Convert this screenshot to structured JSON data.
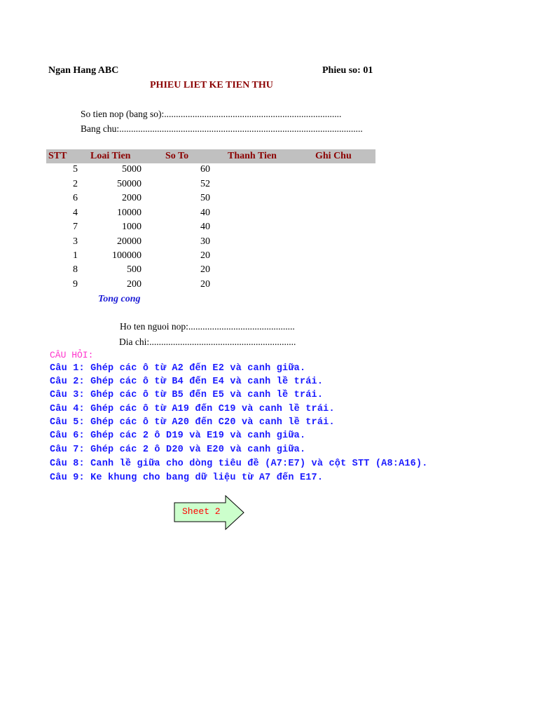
{
  "header": {
    "bank_name": "Ngan Hang ABC",
    "receipt_no": "Phieu so: 01",
    "title": "PHIEU LIET KE TIEN THU"
  },
  "fields": {
    "amount_number": "So tien nop (bang so):...........................................................................",
    "amount_words": "Bang chu:.......................................................................................................",
    "payer_name": "Ho ten nguoi nop:.............................................",
    "address": "Dia chi:.............................................................."
  },
  "table": {
    "columns": [
      "STT",
      "Loai Tien",
      "So To",
      "Thanh Tien",
      "Ghi Chu"
    ],
    "rows": [
      {
        "stt": "5",
        "loai_tien": "5000",
        "so_to": "60"
      },
      {
        "stt": "2",
        "loai_tien": "50000",
        "so_to": "52"
      },
      {
        "stt": "6",
        "loai_tien": "2000",
        "so_to": "50"
      },
      {
        "stt": "4",
        "loai_tien": "10000",
        "so_to": "40"
      },
      {
        "stt": "7",
        "loai_tien": "1000",
        "so_to": "40"
      },
      {
        "stt": "3",
        "loai_tien": "20000",
        "so_to": "30"
      },
      {
        "stt": "1",
        "loai_tien": "100000",
        "so_to": "20"
      },
      {
        "stt": "8",
        "loai_tien": "500",
        "so_to": "20"
      },
      {
        "stt": "9",
        "loai_tien": "200",
        "so_to": "20"
      }
    ],
    "total_label": "Tong cong"
  },
  "questions": {
    "heading": "CÂU HỎI:",
    "items": [
      "Câu 1: Ghép các ô từ A2 đến E2 và canh giữa.",
      "Câu 2: Ghép các ô từ B4 đến E4 và canh lề trái.",
      "Câu 3: Ghép các ô từ B5 đến E5 và canh lề trái.",
      "Câu 4: Ghép các ô từ A19 đến C19 và canh lề trái.",
      "Câu 5: Ghép các ô từ A20 đến C20 và canh lề trái.",
      "Câu 6: Ghép các 2 ô D19 và E19 và canh giữa.",
      "Câu 7: Ghép các 2 ô D20 và E20 và canh giữa.",
      "Câu 8: Canh lề giữa cho dòng tiêu đề (A7:E7) và cột STT (A8:A16).",
      "Câu 9: Ke khung cho bang dữ liệu từ A7 đến E17."
    ]
  },
  "nav": {
    "sheet_button": "Sheet 2"
  },
  "colors": {
    "title": "#8b0000",
    "header_bg": "#c0c0c0",
    "total": "#1b1bd6",
    "question_heading": "#ff33cc",
    "question_text": "#1a1aff",
    "arrow_fill": "#ccffcc",
    "arrow_label": "#ff0000"
  }
}
